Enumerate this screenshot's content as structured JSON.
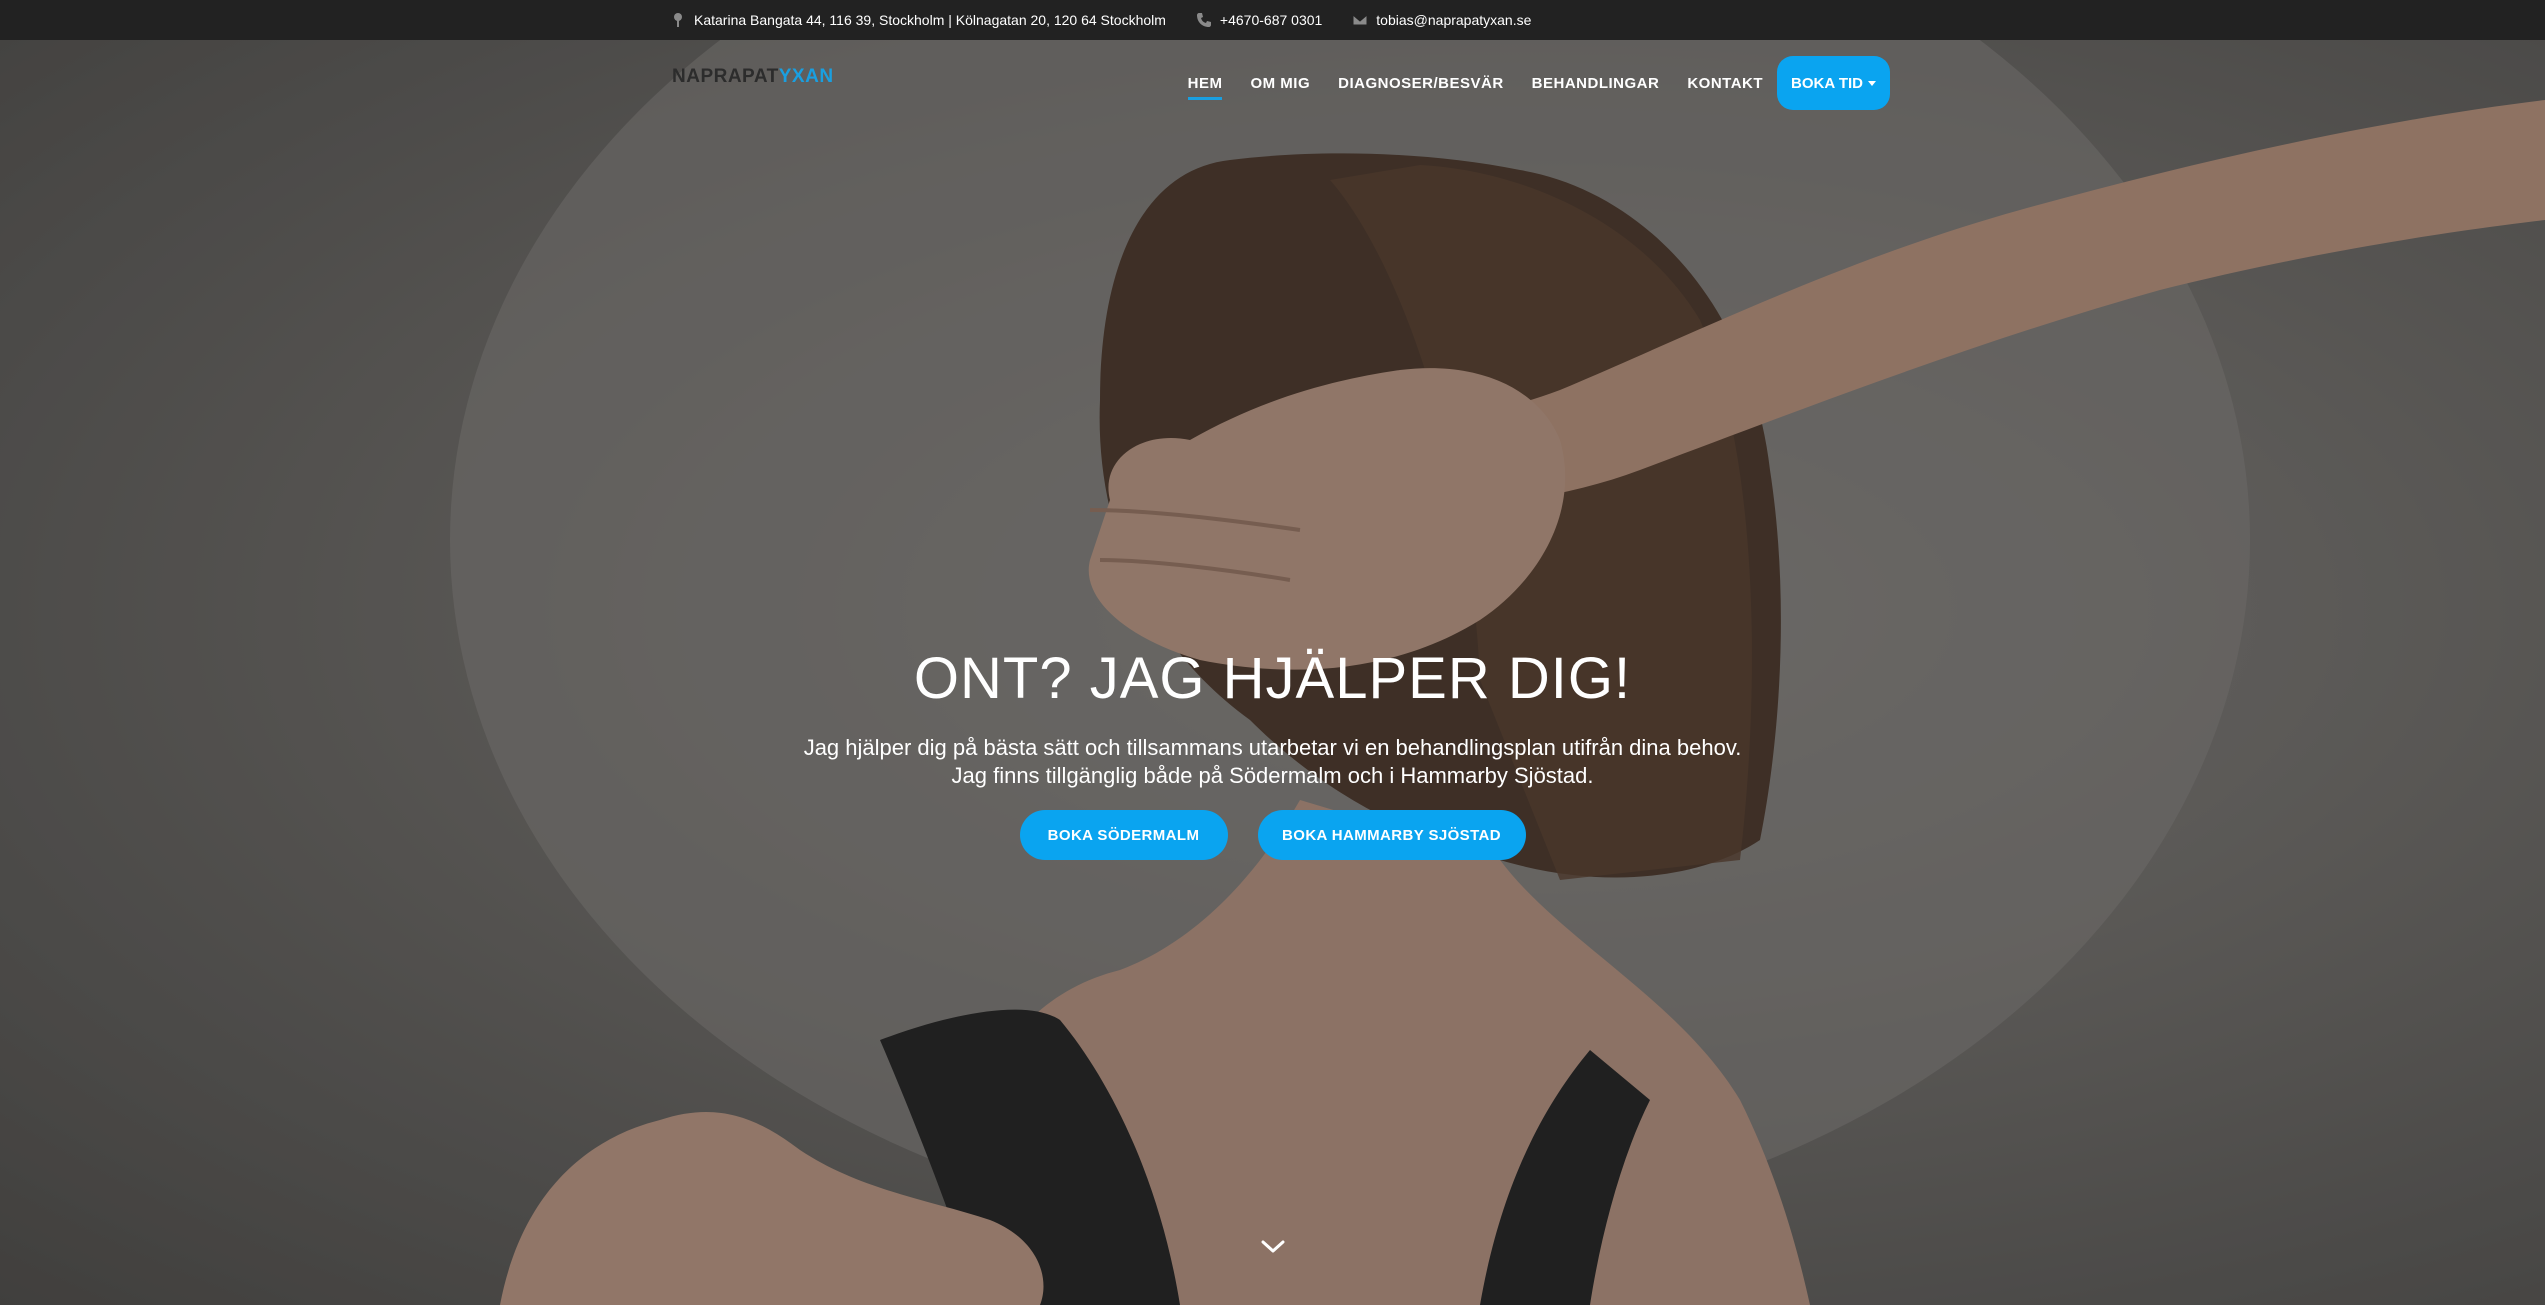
{
  "topbar": {
    "address": "Katarina Bangata 44, 116 39, Stockholm | Kölnagatan 20, 120 64 Stockholm",
    "phone": "+4670-687 0301",
    "email": "tobias@naprapatyxan.se",
    "icons": [
      "map-pin-icon",
      "phone-icon",
      "envelope-icon"
    ]
  },
  "logo": {
    "part1": "NAPRAPAT",
    "part2": "YXAN"
  },
  "nav": {
    "items": [
      {
        "label": "HEM",
        "active": true
      },
      {
        "label": "OM MIG"
      },
      {
        "label": "DIAGNOSER/BESVÄR"
      },
      {
        "label": "BEHANDLINGAR"
      },
      {
        "label": "KONTAKT"
      }
    ],
    "cta": "BOKA TID"
  },
  "hero": {
    "title": "ONT? JAG HJÄLPER DIG!",
    "subtitle_line1": "Jag hjälper dig på bästa sätt och tillsammans utarbetar vi en behandlingsplan utifrån dina behov.",
    "subtitle_line2": "Jag finns tillgänglig både på Södermalm och i Hammarby Sjöstad.",
    "button1": "BOKA SÖDERMALM",
    "button2": "BOKA HAMMARBY SJÖSTAD"
  },
  "colors": {
    "accent": "#0aa4f0",
    "topbar_bg": "#222222",
    "logo_dark": "#2c2c2c",
    "logo_accent": "#1a9fe0"
  }
}
